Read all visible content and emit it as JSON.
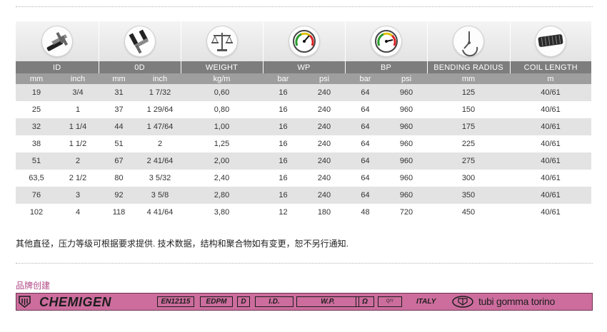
{
  "table": {
    "headers": [
      "ID",
      "0D",
      "WEIGHT",
      "WP",
      "BP",
      "BENDING RADIUS",
      "COIL LENGTH"
    ],
    "icons": [
      "caliper-inner-icon",
      "caliper-outer-icon",
      "scale-balance-icon",
      "pressure-gauge-icon",
      "pressure-gauge-icon",
      "bending-radius-icon",
      "hose-coil-icon"
    ],
    "units": [
      "mm",
      "inch",
      "mm",
      "inch",
      "kg/m",
      "bar",
      "psi",
      "bar",
      "psi",
      "mm",
      "m"
    ],
    "rows": [
      [
        "19",
        "3/4",
        "31",
        "1 7/32",
        "0,60",
        "16",
        "240",
        "64",
        "960",
        "125",
        "40/61"
      ],
      [
        "25",
        "1",
        "37",
        "1 29/64",
        "0,80",
        "16",
        "240",
        "64",
        "960",
        "150",
        "40/61"
      ],
      [
        "32",
        "1 1/4",
        "44",
        "1 47/64",
        "1,00",
        "16",
        "240",
        "64",
        "960",
        "175",
        "40/61"
      ],
      [
        "38",
        "1 1/2",
        "51",
        "2",
        "1,25",
        "16",
        "240",
        "64",
        "960",
        "225",
        "40/61"
      ],
      [
        "51",
        "2",
        "67",
        "2 41/64",
        "2,00",
        "16",
        "240",
        "64",
        "960",
        "275",
        "40/61"
      ],
      [
        "63,5",
        "2 1/2",
        "80",
        "3 5/32",
        "2,40",
        "16",
        "240",
        "64",
        "960",
        "300",
        "40/61"
      ],
      [
        "76",
        "3",
        "92",
        "3 5/8",
        "2,80",
        "16",
        "240",
        "64",
        "960",
        "350",
        "40/61"
      ],
      [
        "102",
        "4",
        "118",
        "4 41/64",
        "3,80",
        "12",
        "180",
        "48",
        "720",
        "450",
        "40/61"
      ]
    ]
  },
  "note": "其他直径，压力等级可根据要求提供. 技术数据，结构和聚合物如有变更，恕不另行通知.",
  "origin_label": "品牌创建",
  "strip": {
    "brand": "CHEMIGEN",
    "boxes": [
      "EN12115",
      "EDPM",
      "D",
      "I.D.",
      "W.P.",
      "Ω"
    ],
    "qty": "Q/Y",
    "country": "ITALY",
    "maker": "tubi gomma torino"
  },
  "colors": {
    "header_bg": "#7d7d7d",
    "units_bg": "#9e9e9e",
    "row_alt_bg": "#e3e3e3",
    "strip_bg": "#cc6d9d",
    "origin_text": "#b24a86"
  }
}
